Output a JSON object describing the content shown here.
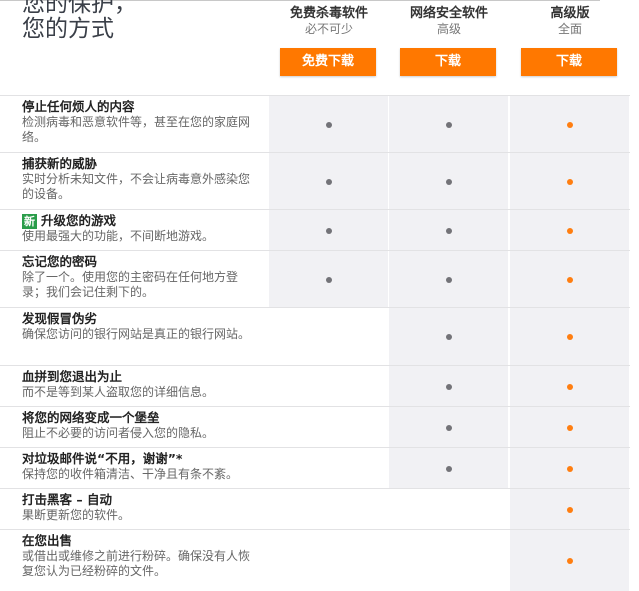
{
  "title_lines": [
    "您的保护，",
    "您的方式"
  ],
  "plans": [
    {
      "name": "免费杀毒软件",
      "subtitle": "必不可少",
      "button": "免费下载"
    },
    {
      "name": "网络安全软件",
      "subtitle": "高级",
      "button": "下载"
    },
    {
      "name": "高级版",
      "subtitle": "全面",
      "button": "下载"
    }
  ],
  "new_badge": "新",
  "features": [
    {
      "title": "停止任何烦人的内容",
      "desc": "检测病毒和恶意软件等，甚至在您的家庭网络。",
      "included": [
        true,
        true,
        true
      ]
    },
    {
      "title": "捕获新的威胁",
      "desc": "实时分析未知文件，不会让病毒意外感染您的设备。",
      "included": [
        true,
        true,
        true
      ]
    },
    {
      "title": "升级您的游戏",
      "desc": "使用最强大的功能，不间断地游戏。",
      "included": [
        true,
        true,
        true
      ],
      "is_new": true
    },
    {
      "title": "忘记您的密码",
      "desc": "除了一个。使用您的主密码在任何地方登录；我们会记住剩下的。",
      "included": [
        true,
        true,
        true
      ]
    },
    {
      "title": "发现假冒伪劣",
      "desc": "确保您访问的银行网站是真正的银行网站。",
      "included": [
        false,
        true,
        true
      ]
    },
    {
      "title": "血拼到您退出为止",
      "desc": "而不是等到某人盗取您的详细信息。",
      "included": [
        false,
        true,
        true
      ]
    },
    {
      "title": "将您的网络变成一个堡垒",
      "desc": "阻止不必要的访问者侵入您的隐私。",
      "included": [
        false,
        true,
        true
      ]
    },
    {
      "title": "对垃圾邮件说“不用，谢谢”*",
      "desc": "保持您的收件箱清洁、干净且有条不紊。",
      "included": [
        false,
        true,
        true
      ]
    },
    {
      "title": "打击黑客 – 自动",
      "desc": "果断更新您的软件。",
      "included": [
        false,
        false,
        true
      ]
    },
    {
      "title": "在您出售",
      "desc": "或借出或维修之前进行粉碎。确保没有人恢复您认为已经粉碎的文件。",
      "included": [
        false,
        false,
        true
      ]
    }
  ],
  "colors": {
    "accent": "#ff7800",
    "dot_gray": "#737378",
    "cell_bg": "#f1f1f4",
    "new_badge": "#2a9d4a"
  }
}
